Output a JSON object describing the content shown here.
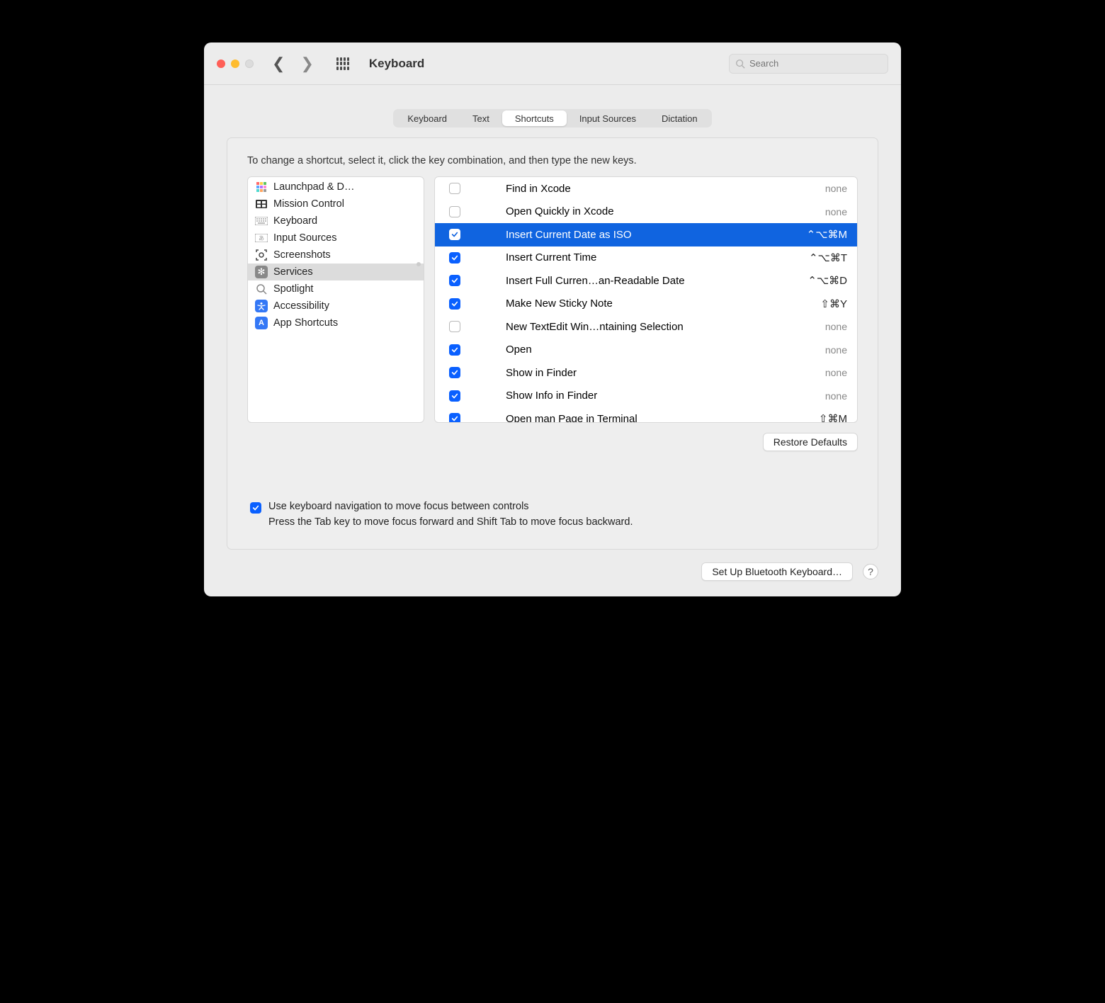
{
  "header": {
    "title": "Keyboard",
    "search_placeholder": "Search"
  },
  "tabs": [
    "Keyboard",
    "Text",
    "Shortcuts",
    "Input Sources",
    "Dictation"
  ],
  "selected_tab": 2,
  "hint": "To change a shortcut, select it, click the key combination, and then type the new keys.",
  "sidebar": {
    "items": [
      {
        "label": "Launchpad & D…",
        "icon": "launchpad"
      },
      {
        "label": "Mission Control",
        "icon": "mission"
      },
      {
        "label": "Keyboard",
        "icon": "keyboard"
      },
      {
        "label": "Input Sources",
        "icon": "input"
      },
      {
        "label": "Screenshots",
        "icon": "screenshot"
      },
      {
        "label": "Services",
        "icon": "gear"
      },
      {
        "label": "Spotlight",
        "icon": "spotlight"
      },
      {
        "label": "Accessibility",
        "icon": "accessibility"
      },
      {
        "label": "App Shortcuts",
        "icon": "app"
      }
    ],
    "selected": 5
  },
  "services": [
    {
      "checked": false,
      "label": "Find in Xcode",
      "shortcut": "none",
      "none": true
    },
    {
      "checked": false,
      "label": "Open Quickly in Xcode",
      "shortcut": "none",
      "none": true
    },
    {
      "checked": true,
      "label": "Insert Current Date as ISO",
      "shortcut": "⌃⌥⌘M",
      "none": false,
      "selected": true
    },
    {
      "checked": true,
      "label": "Insert Current Time",
      "shortcut": "⌃⌥⌘T",
      "none": false
    },
    {
      "checked": true,
      "label": "Insert Full Curren…an-Readable Date",
      "shortcut": "⌃⌥⌘D",
      "none": false
    },
    {
      "checked": true,
      "label": "Make New Sticky Note",
      "shortcut": "⇧⌘Y",
      "none": false
    },
    {
      "checked": false,
      "label": "New TextEdit Win…ntaining Selection",
      "shortcut": "none",
      "none": true
    },
    {
      "checked": true,
      "label": "Open",
      "shortcut": "none",
      "none": true
    },
    {
      "checked": true,
      "label": "Show in Finder",
      "shortcut": "none",
      "none": true
    },
    {
      "checked": true,
      "label": "Show Info in Finder",
      "shortcut": "none",
      "none": true
    },
    {
      "checked": true,
      "label": "Open man Page in Terminal",
      "shortcut": "⇧⌘M",
      "none": false
    }
  ],
  "buttons": {
    "restore": "Restore Defaults",
    "bluetooth": "Set Up Bluetooth Keyboard…"
  },
  "footer": {
    "checkbox_label": "Use keyboard navigation to move focus between controls",
    "sub": "Press the Tab key to move focus forward and Shift Tab to move focus backward."
  }
}
